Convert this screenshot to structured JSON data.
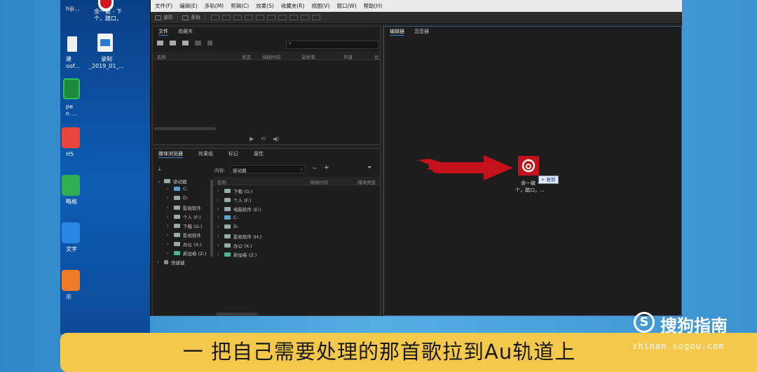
{
  "menu": [
    "文件(F)",
    "编辑(E)",
    "多轨(M)",
    "剪辑(C)",
    "效果(S)",
    "收藏夹(R)",
    "视图(V)",
    "窗口(W)",
    "帮助(H)"
  ],
  "toolbar": {
    "waveform": "波形",
    "multitrack": "多轨"
  },
  "files_panel": {
    "tabs": [
      "文件",
      "收藏夹"
    ],
    "columns": [
      "名称",
      "状态",
      "持续时间",
      "采样率",
      "声道",
      "位"
    ]
  },
  "browser_panel": {
    "tabs": [
      "媒体浏览器",
      "效果组",
      "标记",
      "属性"
    ],
    "content_label": "内容:",
    "content_value": "驱动器",
    "left_tree": [
      "驱动器",
      "C:",
      "D:",
      "影视软件",
      "个人 (F:)",
      "下载 (G:)",
      "影视软件",
      "办公 (X:)",
      "新加卷 (Z:)",
      "快捷键"
    ],
    "columns": [
      "名称",
      "持续时间",
      "媒体类型"
    ],
    "drives": [
      "下载 (G:)",
      "个人 (F:)",
      "电脑软件 (E:)",
      "C:",
      "D:",
      "影视软件 (H:)",
      "办公 (X:)",
      "新加卷 (Z:)"
    ]
  },
  "editor_panel": {
    "tabs": [
      "编辑器",
      "混音器"
    ]
  },
  "drag": {
    "badge": "+ 复制",
    "file_label_1": "余一破 -",
    "file_label_2": "个，踏口，..."
  },
  "desktop": {
    "top_label_1": "余一破 - 下",
    "top_label_2": "个，踏口，",
    "recording_1": "录制",
    "recording_2": "_2019_01_...",
    "side_labels": [
      "hiji...",
      "建",
      "oof...",
      "pe",
      "n ...",
      "H5",
      "略格",
      "文字",
      "示"
    ]
  },
  "subtitle": "一 把自己需要处理的那首歌拉到Au轨道上",
  "watermark": {
    "brand": "搜狗指南",
    "url": "zhinan.sogou.com"
  },
  "colors": {
    "accent_red": "#c4121a",
    "subtitle_bg": "#f3c84b",
    "app_bg": "#232323"
  }
}
